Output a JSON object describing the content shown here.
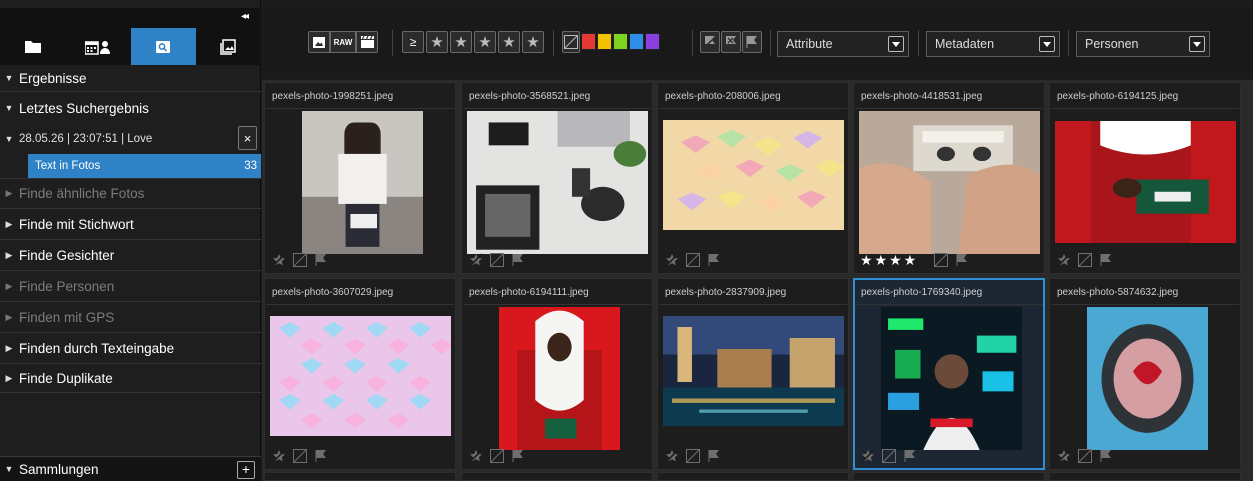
{
  "sidebar": {
    "collapse_label": "◂◂",
    "tabs": [
      {
        "name": "folder",
        "icon": "folder-icon"
      },
      {
        "name": "calendar-people",
        "icon": "calendar-person-icon"
      },
      {
        "name": "search",
        "icon": "search-icon",
        "active": true
      },
      {
        "name": "collections",
        "icon": "photo-stack-icon"
      }
    ],
    "results_label": "Ergebnisse",
    "last_search_label": "Letztes Suchergebnis",
    "search_entry": "28.05.26 | 23:07:51 | Love",
    "close_label": "×",
    "text_in_photos_label": "Text in Fotos",
    "text_in_photos_count": "33",
    "items": [
      {
        "label": "Finde ähnliche Fotos",
        "enabled": false
      },
      {
        "label": "Finde mit Stichwort",
        "enabled": true
      },
      {
        "label": "Finde Gesichter",
        "enabled": true
      },
      {
        "label": "Finde Personen",
        "enabled": false
      },
      {
        "label": "Finden mit GPS",
        "enabled": false
      },
      {
        "label": "Finden durch Texteingabe",
        "enabled": true
      },
      {
        "label": "Finde Duplikate",
        "enabled": true
      }
    ],
    "collections_label": "Sammlungen",
    "add_label": "+"
  },
  "toolbar": {
    "raw_label": "RAW",
    "gte_label": "≥",
    "stars": [
      "★",
      "★",
      "★",
      "★",
      "★"
    ],
    "colors": [
      "#e53935",
      "#f2c200",
      "#7ed321",
      "#2e8ee8",
      "#8b3fe0"
    ],
    "attribute_label": "Attribute",
    "metadata_label": "Metadaten",
    "people_label": "Personen"
  },
  "photos": [
    {
      "file": "pexels-photo-1998251.jpeg",
      "rating": ""
    },
    {
      "file": "pexels-photo-3568521.jpeg",
      "rating": ""
    },
    {
      "file": "pexels-photo-208006.jpeg",
      "rating": ""
    },
    {
      "file": "pexels-photo-4418531.jpeg",
      "rating": "★★★★"
    },
    {
      "file": "pexels-photo-6194125.jpeg",
      "rating": ""
    },
    {
      "file": "pexels-photo-3607029.jpeg",
      "rating": ""
    },
    {
      "file": "pexels-photo-6194111.jpeg",
      "rating": ""
    },
    {
      "file": "pexels-photo-2837909.jpeg",
      "rating": ""
    },
    {
      "file": "pexels-photo-1769340.jpeg",
      "rating": "",
      "selected": true
    },
    {
      "file": "pexels-photo-5874632.jpeg",
      "rating": ""
    }
  ]
}
